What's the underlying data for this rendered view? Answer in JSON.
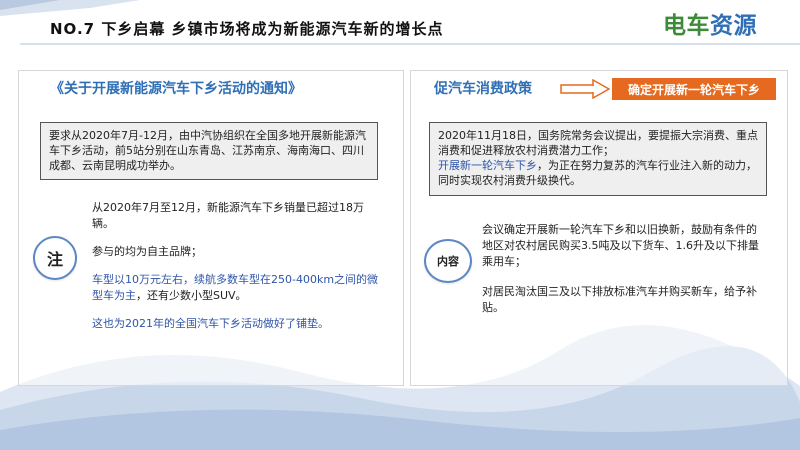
{
  "header": {
    "title": "NO.7  下乡启幕  乡镇市场将成为新能源汽车新的增长点",
    "logo_a": "电车",
    "logo_b": "资源"
  },
  "left": {
    "notice_title": "《关于开展新能源汽车下乡活动的通知》",
    "box_text": "要求从2020年7月-12月，由中汽协组织在全国多地开展新能源汽车下乡活动，前5站分别在山东青岛、江苏南京、海南海口、四川成都、云南昆明成功举办。",
    "circle_label": "注",
    "notes": [
      "从2020年7月至12月，新能源汽车下乡销量已超过18万辆。",
      "参与的均为自主品牌；",
      "车型以10万元左右，续航多数车型在250-400km之间的微型车为主",
      "，还有少数小型SUV。",
      "这也为2021年的全国汽车下乡活动做好了铺垫。"
    ]
  },
  "right": {
    "policy_title": "促汽车消费政策",
    "orange_label": "确定开展新一轮汽车下乡",
    "box_line1": "2020年11月18日，国务院常务会议提出，要提振大宗消费、重点消费和促进释放农村消费潜力工作；",
    "box_highlight": "开展新一轮汽车下乡",
    "box_line2": "，为正在努力复苏的汽车行业注入新的动力，同时实现农村消费升级换代。",
    "circle_label": "内容",
    "content": [
      "会议确定开展新一轮汽车下乡和以旧换新，鼓励有条件的地区对农村居民购买3.5吨及以下货车、1.6升及以下排量乘用车；",
      "对居民淘汰国三及以下排放标准汽车并购买新车，给予补贴。"
    ]
  },
  "colors": {
    "accent_blue": "#2f6fb6",
    "orange": "#e56a1f",
    "logo_green": "#3d8a3a"
  }
}
